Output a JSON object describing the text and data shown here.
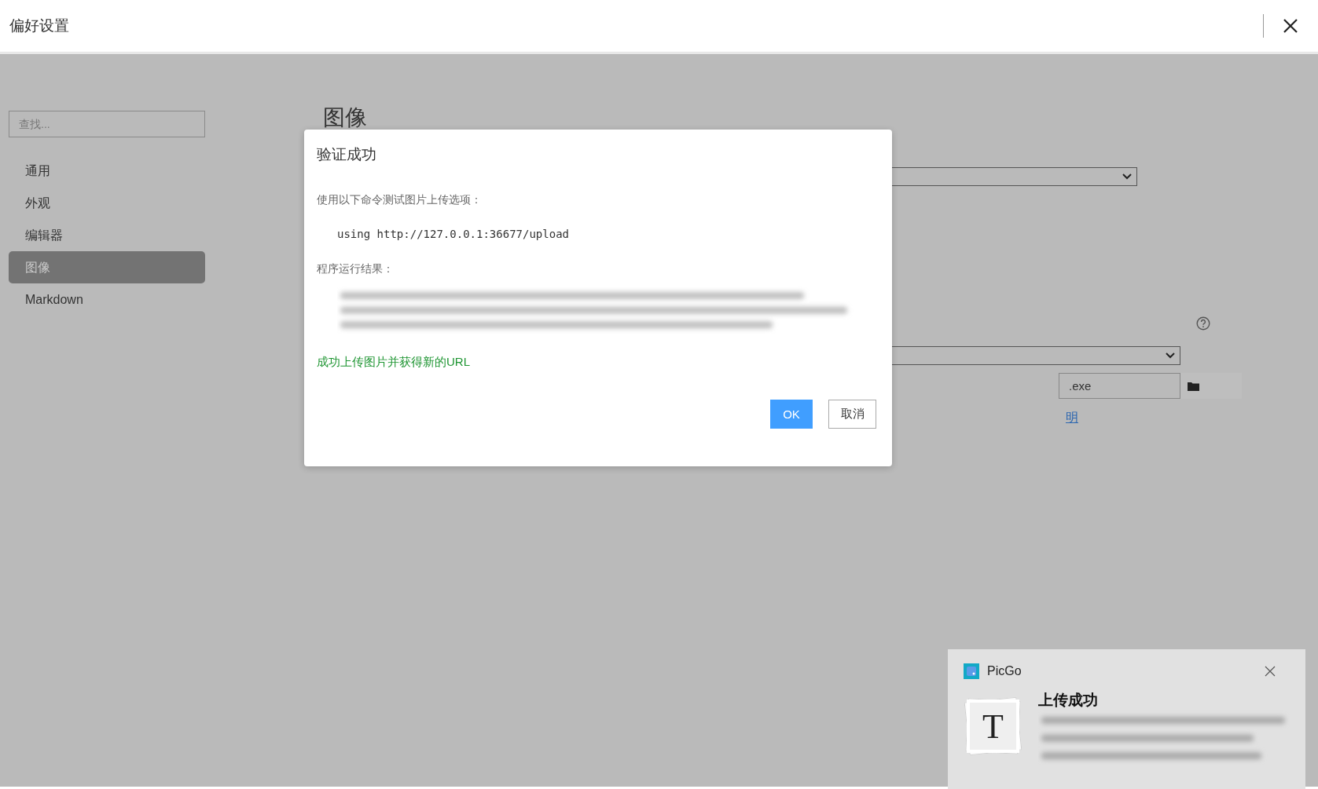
{
  "window": {
    "title": "偏好设置"
  },
  "sidebar": {
    "search": {
      "placeholder": "查找..."
    },
    "items": [
      {
        "label": "通用",
        "selected": false
      },
      {
        "label": "外观",
        "selected": false
      },
      {
        "label": "编辑器",
        "selected": false
      },
      {
        "label": "图像",
        "selected": true
      },
      {
        "label": "Markdown",
        "selected": false
      }
    ]
  },
  "page": {
    "heading": "图像",
    "path_field": {
      "value": ".exe"
    },
    "link": "明"
  },
  "dialog": {
    "title": "验证成功",
    "command_label": "使用以下命令测试图片上传选项：",
    "command": "using http://127.0.0.1:36677/upload",
    "result_label": "程序运行结果：",
    "status": "成功上传图片并获得新的URL",
    "buttons": [
      {
        "label": "OK",
        "kind": "primary"
      },
      {
        "label": "取消",
        "kind": "default"
      }
    ]
  },
  "notification": {
    "app": "PicGo",
    "title": "上传成功",
    "icon_letter": "T"
  }
}
